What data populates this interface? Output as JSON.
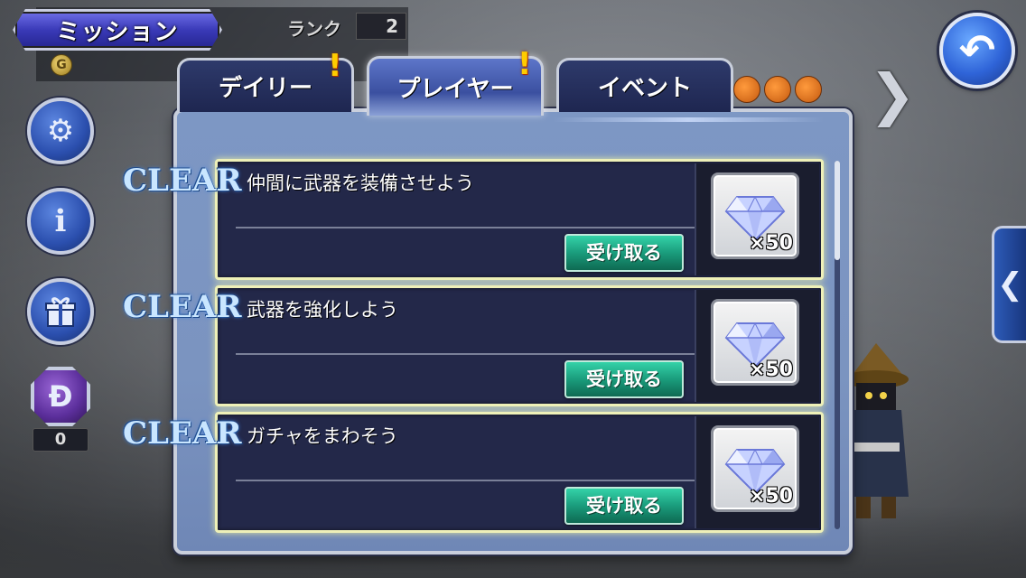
{
  "header": {
    "title": "ミッション",
    "rank_label": "ランク",
    "rank_value": "2",
    "coin_symbol": "G"
  },
  "tabs": [
    {
      "label": "デイリー",
      "alert": "!",
      "active": false
    },
    {
      "label": "プレイヤー",
      "alert": "!",
      "active": true
    },
    {
      "label": "イベント",
      "alert": "",
      "active": false
    }
  ],
  "side": {
    "dark_count": "0"
  },
  "missions": [
    {
      "status": "CLEAR",
      "title": "仲間に武器を装備させよう",
      "button": "受け取る",
      "reward_icon": "crystal-gem",
      "reward_count": "×50"
    },
    {
      "status": "CLEAR",
      "title": "武器を強化しよう",
      "button": "受け取る",
      "reward_icon": "crystal-gem",
      "reward_count": "×50"
    },
    {
      "status": "CLEAR",
      "title": "ガチャをまわそう",
      "button": "受け取る",
      "reward_icon": "crystal-gem",
      "reward_count": "×50"
    }
  ],
  "colors": {
    "accent_blue": "#2f64d8",
    "receive_green": "#1a9c7c",
    "alert_yellow": "#ffcc00",
    "clear_glow": "#c9e6ff"
  }
}
